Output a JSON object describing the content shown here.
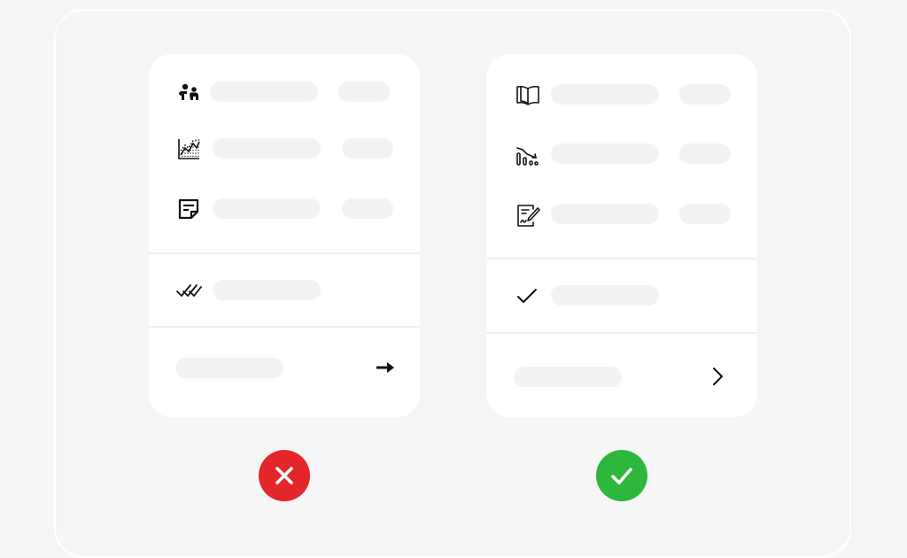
{
  "comparison": {
    "bad": {
      "icons": [
        "people-icon",
        "area-chart-icon",
        "note-icon",
        "double-check-icon",
        "arrow-right-icon"
      ],
      "status_icon": "cross-icon",
      "status_color": "#e3262a"
    },
    "good": {
      "icons": [
        "open-book-icon",
        "declining-bar-chart-icon",
        "signed-document-icon",
        "check-icon",
        "chevron-right-icon"
      ],
      "status_icon": "check-icon",
      "status_color": "#2db83d"
    }
  }
}
